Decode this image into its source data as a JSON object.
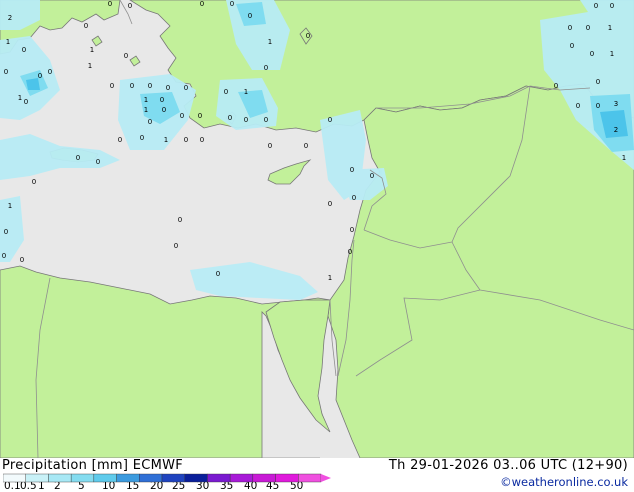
{
  "map": {
    "region": "Eastern Mediterranean",
    "colors": {
      "sea": "#e8e8e8",
      "land": "#c2f09a",
      "border": "#8f8f8f",
      "coast": "#777777",
      "precip_light": "#b8ecf5",
      "precip_medium": "#7fdcf0",
      "precip_heavy": "#4cc4ea"
    },
    "precip_value_labels": [
      "2",
      "0",
      "1",
      "0",
      "0",
      "0",
      "1",
      "0",
      "0",
      "0",
      "1",
      "0",
      "1",
      "0",
      "0",
      "0",
      "1",
      "0",
      "0",
      "0",
      "0",
      "0",
      "1",
      "0",
      "0",
      "0",
      "0",
      "1",
      "0",
      "0",
      "1",
      "0",
      "0",
      "0",
      "0",
      "0",
      "0",
      "0",
      "0",
      "0",
      "0",
      "0",
      "0",
      "0",
      "0",
      "0",
      "0",
      "1",
      "0",
      "1",
      "0",
      "0",
      "0",
      "0",
      "0",
      "0",
      "1",
      "0",
      "0",
      "1",
      "0",
      "0",
      "0",
      "3",
      "2",
      "1",
      "0",
      "0",
      "0",
      "0",
      "1",
      "0",
      "0",
      "0",
      "0",
      "0",
      "0"
    ]
  },
  "legend": {
    "title": "Precipitation [mm]  ECMWF",
    "valid_time": "Th 29-01-2026 03..06 UTC (12+90)",
    "credit": "©weatheronline.co.uk",
    "scale_labels": [
      "0.1",
      "0.5",
      "1",
      "2",
      "5",
      "10",
      "15",
      "20",
      "25",
      "30",
      "35",
      "40",
      "45",
      "50"
    ],
    "scale_colors": [
      "#f2fafc",
      "#c9f1f7",
      "#a8e8f5",
      "#84dcf0",
      "#5fcbec",
      "#3c9bdf",
      "#2f6fd6",
      "#1f43bf",
      "#0a1f9a",
      "#7a1ad0",
      "#a81ad8",
      "#c81ad6",
      "#e01adc",
      "#f050e0"
    ]
  }
}
